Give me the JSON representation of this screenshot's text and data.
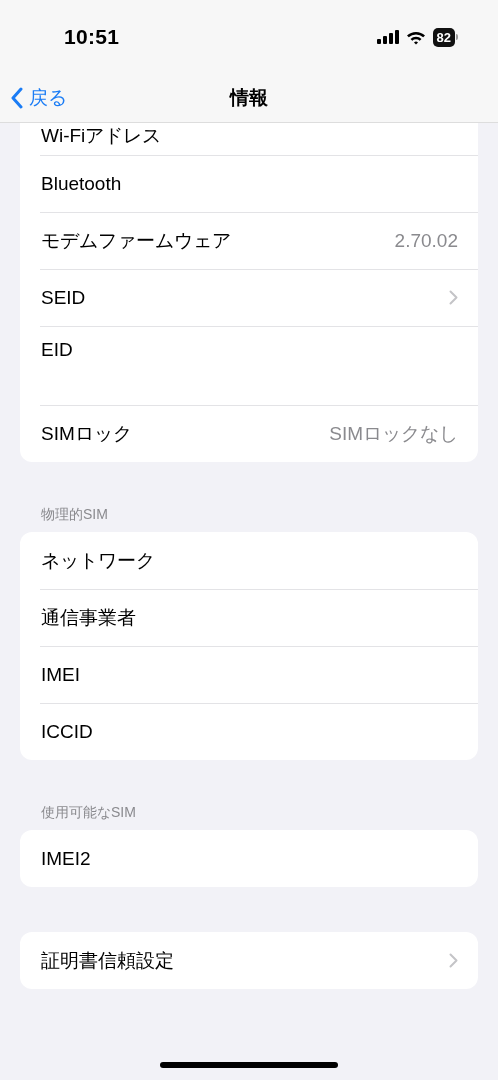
{
  "status_bar": {
    "time": "10:51",
    "battery": "82"
  },
  "nav_bar": {
    "back": "戻る",
    "title": "情報"
  },
  "groups": [
    {
      "rows": [
        {
          "kind": "partial",
          "label": "Wi-Fiアドレス"
        },
        {
          "kind": "plain",
          "label": "Bluetooth"
        },
        {
          "kind": "value",
          "label": "モデムファームウェア",
          "value": "2.70.02"
        },
        {
          "kind": "link",
          "label": "SEID"
        },
        {
          "kind": "tall",
          "label": "EID"
        },
        {
          "kind": "value",
          "label": "SIMロック",
          "value": "SIMロックなし"
        }
      ]
    },
    {
      "header": "物理的SIM",
      "rows": [
        {
          "kind": "plain",
          "label": "ネットワーク"
        },
        {
          "kind": "plain",
          "label": "通信事業者"
        },
        {
          "kind": "plain",
          "label": "IMEI"
        },
        {
          "kind": "plain",
          "label": "ICCID"
        }
      ]
    },
    {
      "header": "使用可能なSIM",
      "rows": [
        {
          "kind": "plain",
          "label": "IMEI2"
        }
      ]
    },
    {
      "rows": [
        {
          "kind": "link",
          "label": "証明書信頼設定"
        }
      ]
    }
  ]
}
